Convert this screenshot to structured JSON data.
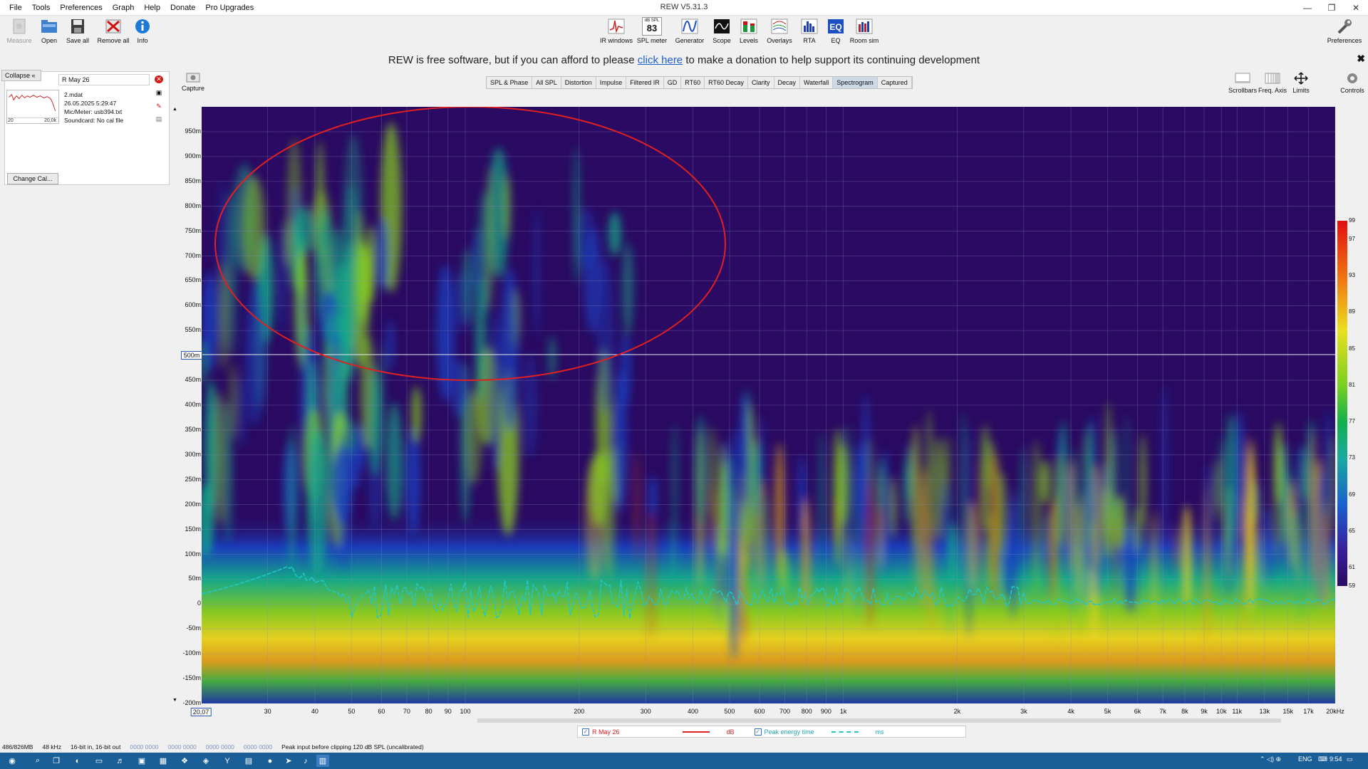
{
  "window": {
    "title": "REW V5.31.3"
  },
  "menu": [
    "File",
    "Tools",
    "Preferences",
    "Graph",
    "Help",
    "Donate",
    "Pro Upgrades"
  ],
  "window_controls": [
    "—",
    "❐",
    "✕"
  ],
  "toolbar_left": [
    {
      "label": "Measure",
      "icon": "measure-icon",
      "enabled": false
    },
    {
      "label": "Open",
      "icon": "open-folder-icon",
      "enabled": true
    },
    {
      "label": "Save all",
      "icon": "save-icon",
      "enabled": true
    },
    {
      "label": "Remove all",
      "icon": "remove-icon",
      "enabled": true
    },
    {
      "label": "Info",
      "icon": "info-icon",
      "enabled": true
    }
  ],
  "toolbar_center": [
    {
      "label": "IR windows",
      "icon": "ir-windows-icon"
    },
    {
      "label": "SPL meter",
      "icon": "spl-meter-icon",
      "badge_top": "dB SPL",
      "badge": "83"
    },
    {
      "label": "Generator",
      "icon": "generator-icon"
    },
    {
      "label": "Scope",
      "icon": "scope-icon"
    },
    {
      "label": "Levels",
      "icon": "levels-icon"
    },
    {
      "label": "Overlays",
      "icon": "overlays-icon"
    },
    {
      "label": "RTA",
      "icon": "rta-icon"
    },
    {
      "label": "EQ",
      "icon": "eq-icon"
    },
    {
      "label": "Room sim",
      "icon": "room-sim-icon"
    }
  ],
  "toolbar_right": {
    "label": "Preferences",
    "icon": "wrench-icon"
  },
  "donation": {
    "before": "REW is free software, but if you can afford to please ",
    "link": "click here",
    "after": " to make a donation to help support its continuing development"
  },
  "panel": {
    "collapse_label": "Collapse",
    "collapse_glyph": "«",
    "measurement_name": "R May 26",
    "file": "2.mdat",
    "date": "26.05.2025 5:29:47",
    "mic": "Mic/Meter: usb394.txt",
    "soundcard": "Soundcard: No cal file",
    "thumb_left": "20",
    "thumb_right": "20,0k",
    "change_cal": "Change Cal..."
  },
  "capture": {
    "label": "Capture"
  },
  "tabs": [
    "SPL & Phase",
    "All SPL",
    "Distortion",
    "Impulse",
    "Filtered IR",
    "GD",
    "RT60",
    "RT60 Decay",
    "Clarity",
    "Decay",
    "Waterfall",
    "Spectrogram",
    "Captured"
  ],
  "active_tab": "Spectrogram",
  "right_tools": [
    "Scrollbars",
    "Freq. Axis",
    "Limits",
    "Controls"
  ],
  "chart_data": {
    "type": "heatmap",
    "title": "",
    "xlabel": "",
    "ylabel": "",
    "x_scale": "log",
    "xlim": [
      20.07,
      20000
    ],
    "ylim": [
      -200,
      1000
    ],
    "x_ticks": [
      "30",
      "40",
      "50",
      "60",
      "70",
      "80",
      "90",
      "100",
      "200",
      "300",
      "400",
      "500",
      "600",
      "700",
      "800",
      "900",
      "1k",
      "2k",
      "3k",
      "4k",
      "5k",
      "6k",
      "7k",
      "8k",
      "9k",
      "10k",
      "11k",
      "13k",
      "15k",
      "17k",
      "20kHz"
    ],
    "x_cursor": "20,07",
    "y_ticks": [
      "950m",
      "900m",
      "850m",
      "800m",
      "750m",
      "700m",
      "650m",
      "600m",
      "550m",
      "450m",
      "400m",
      "350m",
      "300m",
      "250m",
      "200m",
      "150m",
      "100m",
      "50m",
      "0",
      "-50m",
      "-100m",
      "-150m",
      "-200m"
    ],
    "y_cursor": "500m",
    "color_scale": {
      "min": 59,
      "max": 99,
      "unit": "dB",
      "ticks": [
        "99",
        "97",
        "93",
        "89",
        "85",
        "81",
        "77",
        "73",
        "69",
        "65",
        "61",
        "59"
      ]
    },
    "series": [
      {
        "name": "R May 26",
        "unit": "dB",
        "color": "#e02020",
        "style": "solid"
      },
      {
        "name": "Peak energy time",
        "unit": "ms",
        "color": "#23c7c7",
        "style": "dashed"
      }
    ]
  },
  "status": {
    "memory": "486/826MB",
    "rate": "48 kHz",
    "bits": "16-bit in, 16-bit out",
    "meters": [
      "0000 0000",
      "0000 0000",
      "0000 0000",
      "0000 0000"
    ],
    "message": "Peak input before clipping 120 dB SPL (uncalibrated)"
  },
  "taskbar": {
    "lang": "ENG",
    "time": "9:54"
  }
}
